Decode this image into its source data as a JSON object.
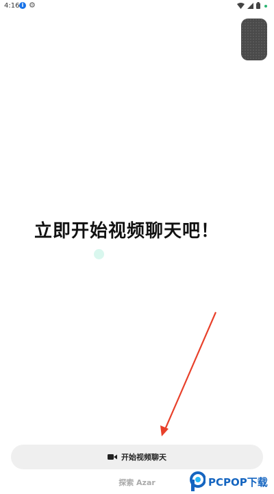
{
  "status_bar": {
    "time": "4:16",
    "info_badge": "i"
  },
  "main": {
    "headline": "立即开始视频聊天吧！"
  },
  "start_button": {
    "label": "开始视频聊天"
  },
  "explore_link": {
    "label": "探索 Azar"
  },
  "watermark": {
    "text": "PCPOP下载"
  },
  "icons": {
    "status": [
      "info-icon",
      "gear-icon",
      "wifi-icon",
      "signal-icon",
      "battery-icon"
    ],
    "button": "video-camera-icon"
  },
  "colors": {
    "background": "#ffffff",
    "button_bg": "#efefef",
    "arrow": "#e8402a",
    "watermark": "#1565c0"
  }
}
